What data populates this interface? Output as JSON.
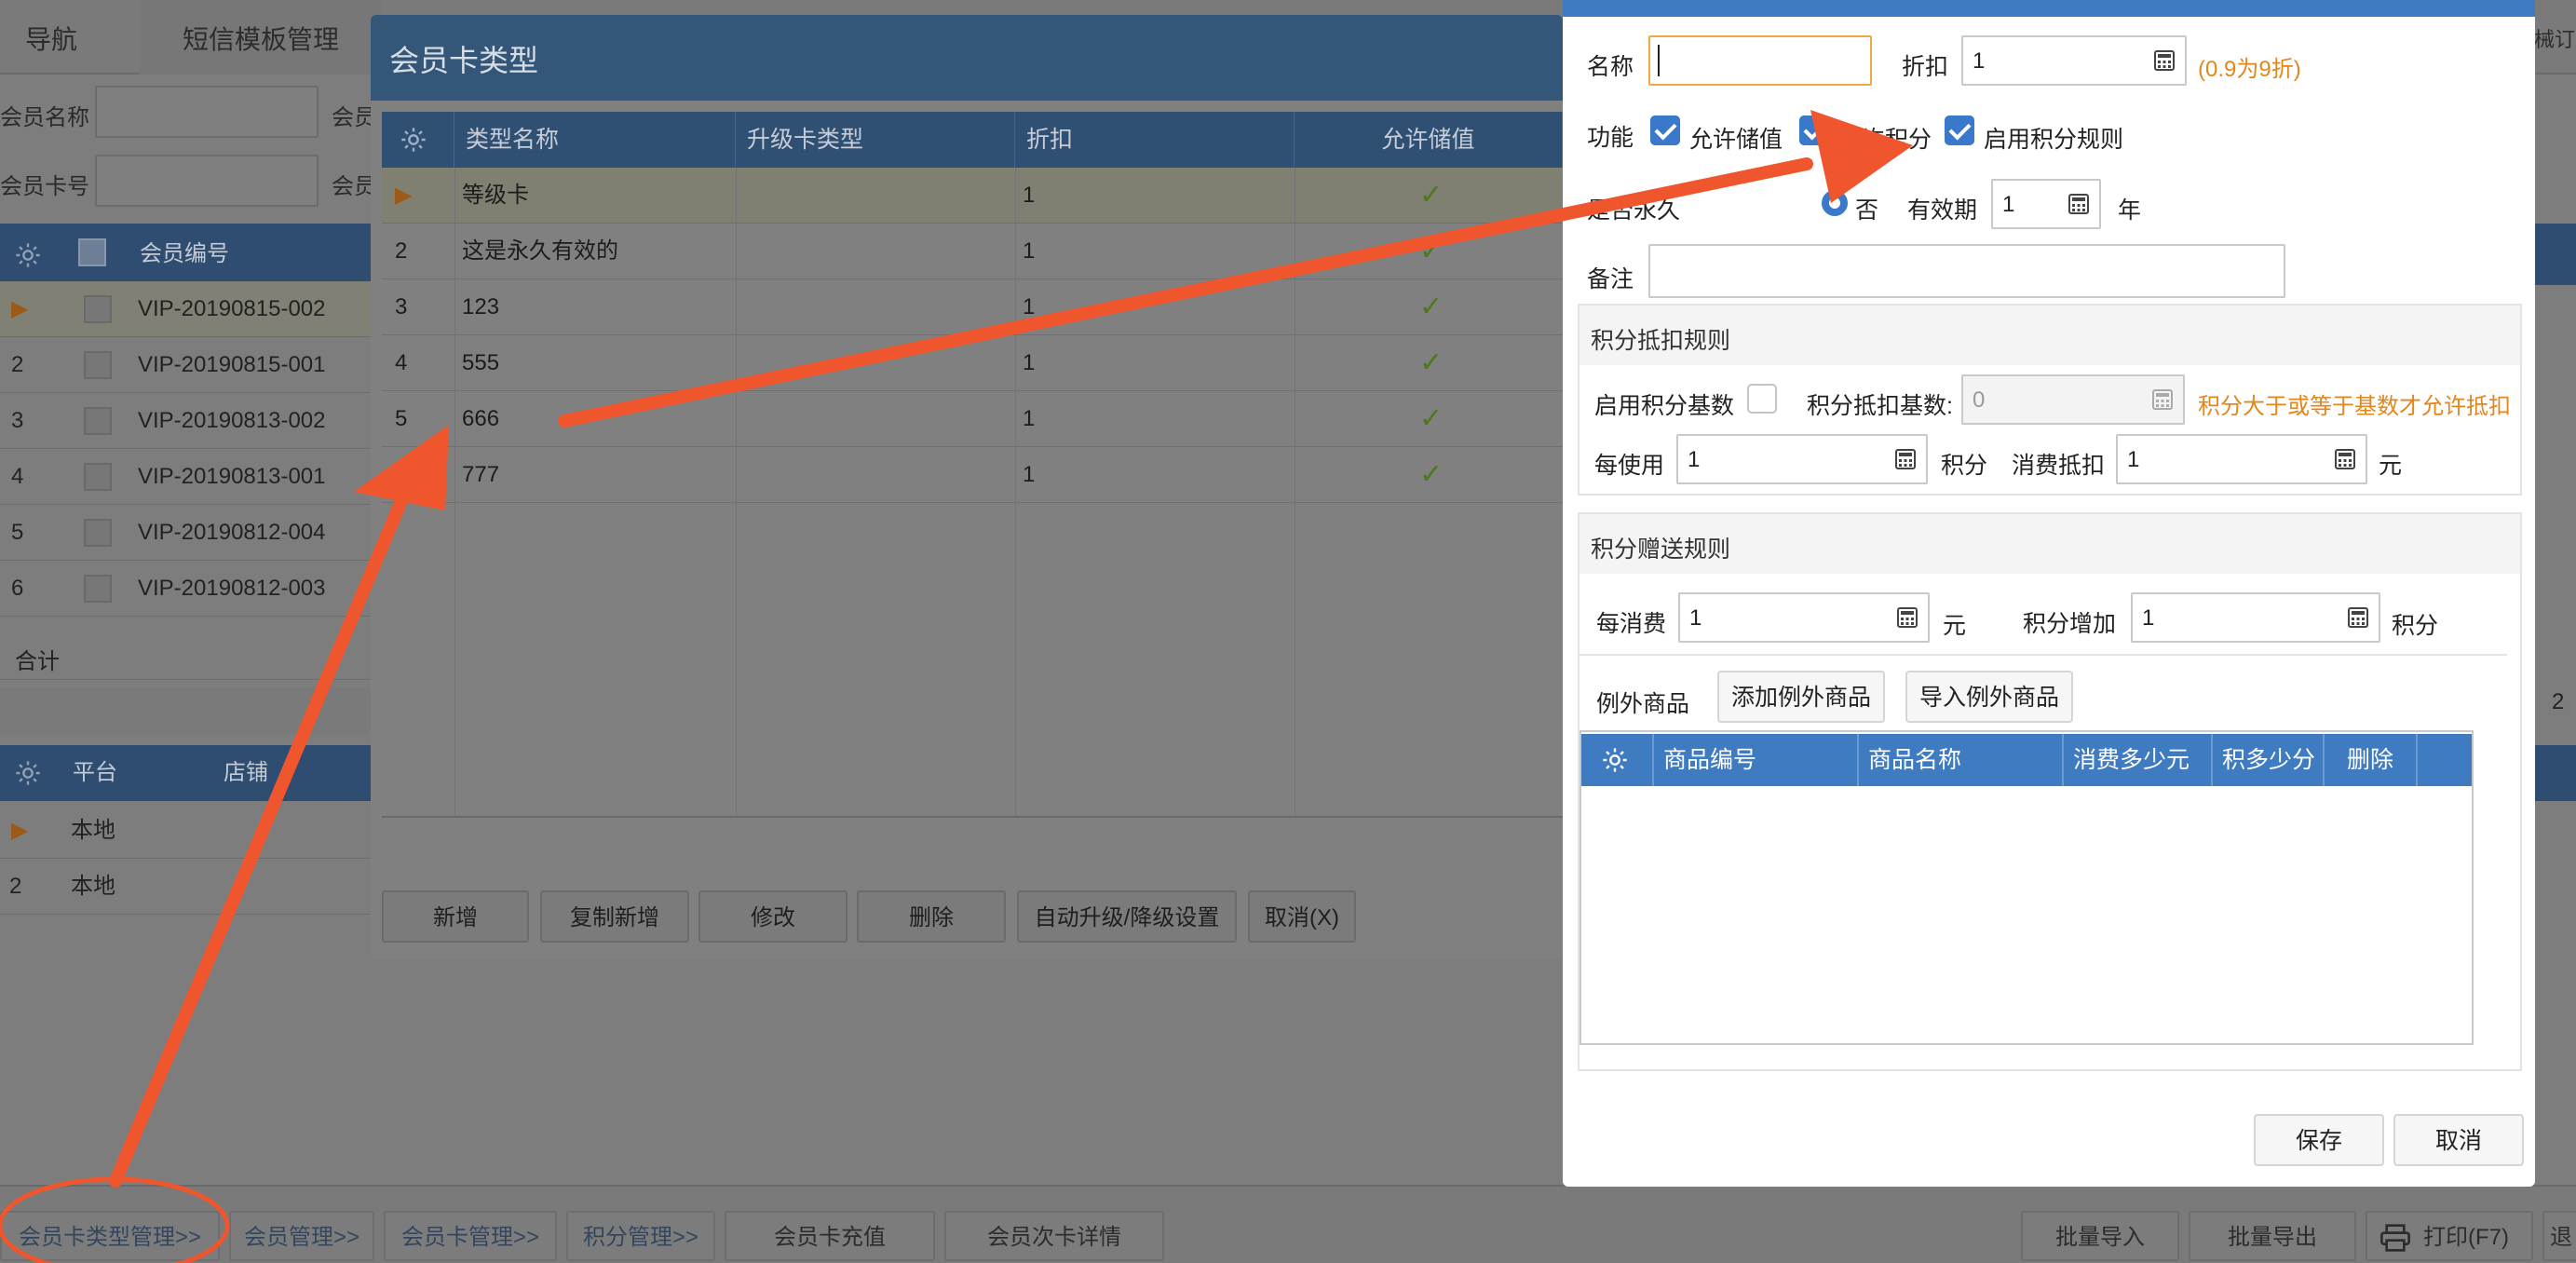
{
  "nav": {
    "tabs": [
      "导航",
      "短信模板管理"
    ],
    "right_cut": "械订",
    "search": {
      "member_name": "会员名称",
      "member_card": "会员卡号",
      "cut_label": "会员"
    }
  },
  "member_table": {
    "headers": [
      "会员编号"
    ],
    "rows": [
      {
        "n": "▶",
        "id": "VIP-20190815-002"
      },
      {
        "n": "2",
        "id": "VIP-20190815-001"
      },
      {
        "n": "3",
        "id": "VIP-20190813-002"
      },
      {
        "n": "4",
        "id": "VIP-20190813-001"
      },
      {
        "n": "5",
        "id": "VIP-20190812-004"
      },
      {
        "n": "6",
        "id": "VIP-20190812-003"
      }
    ],
    "total": "合计",
    "cut_num": "2"
  },
  "platform_table": {
    "headers": [
      "平台",
      "店铺"
    ],
    "rows": [
      {
        "n": "▶",
        "p": "本地"
      },
      {
        "n": "2",
        "p": "本地"
      }
    ]
  },
  "bottom_buttons": {
    "card_type_mgmt": "会员卡类型管理>>",
    "member_mgmt": "会员管理>>",
    "card_mgmt": "会员卡管理>>",
    "points_mgmt": "积分管理>>",
    "recharge": "会员卡充值",
    "times_card": "会员次卡详情",
    "batch_import": "批量导入",
    "batch_export": "批量导出",
    "print": "打印(F7)",
    "exit_cut": "退"
  },
  "card_type_dialog": {
    "title": "会员卡类型",
    "headers": [
      "类型名称",
      "升级卡类型",
      "折扣",
      "允许储值"
    ],
    "rows": [
      {
        "n": "▶",
        "name": "等级卡",
        "discount": "1",
        "check": "✓"
      },
      {
        "n": "2",
        "name": "这是永久有效的",
        "discount": "1",
        "check": "✓"
      },
      {
        "n": "3",
        "name": "123",
        "discount": "1",
        "check": "✓"
      },
      {
        "n": "4",
        "name": "555",
        "discount": "1",
        "check": "✓"
      },
      {
        "n": "5",
        "name": "666",
        "discount": "1",
        "check": "✓"
      },
      {
        "n": "6",
        "name": "777",
        "discount": "1",
        "check": "✓"
      }
    ],
    "buttons": {
      "add": "新增",
      "copy_add": "复制新增",
      "edit": "修改",
      "delete": "删除",
      "auto_upgrade": "自动升级/降级设置",
      "cancel": "取消(X)"
    }
  },
  "edit_dialog": {
    "name_label": "名称",
    "name_value": "",
    "discount_label": "折扣",
    "discount_value": "1",
    "discount_hint": "(0.9为9折)",
    "func_label": "功能",
    "allow_stored": "允许储值",
    "allow_points": "允许积分",
    "enable_rules": "启用积分规则",
    "permanent_label": "是否永久",
    "no_label": "否",
    "validity_label": "有效期",
    "validity_value": "1",
    "year_label": "年",
    "remark_label": "备注",
    "remark_value": "",
    "deduct_section": {
      "title": "积分抵扣规则",
      "enable_base": "启用积分基数",
      "base_label": "积分抵扣基数:",
      "base_value": "0",
      "base_hint": "积分大于或等于基数才允许抵扣",
      "per_use": "每使用",
      "per_use_value": "1",
      "points_unit": "积分",
      "deduct_label": "消费抵扣",
      "deduct_value": "1",
      "yuan_unit": "元"
    },
    "gift_section": {
      "title": "积分赠送规则",
      "per_spend": "每消费",
      "per_spend_value": "1",
      "yuan_unit": "元",
      "points_add": "积分增加",
      "points_add_value": "1",
      "points_unit": "积分",
      "exception_label": "例外商品",
      "add_exception": "添加例外商品",
      "import_exception": "导入例外商品",
      "grid_headers": [
        "商品编号",
        "商品名称",
        "消费多少元",
        "积多少分",
        "删除"
      ]
    },
    "save": "保存",
    "cancel": "取消"
  },
  "colors": {
    "accent_blue": "#3f7bc1",
    "arrow": "#f0562d",
    "hint_orange": "#e3861c"
  }
}
